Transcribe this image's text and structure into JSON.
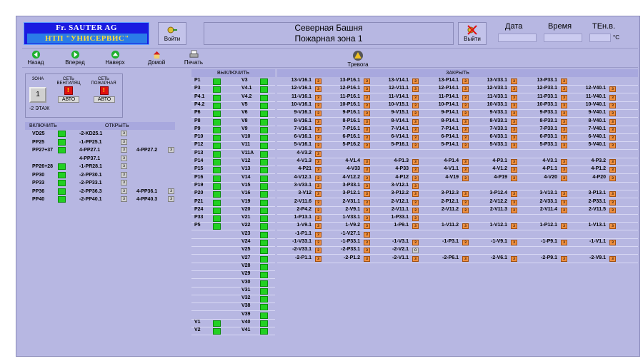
{
  "header": {
    "logo_line1": "Fr. SAUTER AG",
    "logo_line2": "НТП \"УНИСЕРВИС\"",
    "login_label": "Войти",
    "title_line1": "Северная Башня",
    "title_line2": "Пожарная зона 1",
    "logout_label": "Выйти",
    "date_label": "Дата",
    "time_label": "Время",
    "temp_label": "TEн.в.",
    "temp_unit": "°C"
  },
  "nav": [
    "Назад",
    "Вперед",
    "Наверх",
    "Домой",
    "Печать"
  ],
  "alarm_label": "Тревога",
  "zone": {
    "h_zone": "ЗОНА",
    "h_net": "СЕТЬ ВЕНТИЛЯЦ",
    "h_fire": "СЕТЬ ПОЖАРНАЯ",
    "button": "1",
    "auto1": "АВТО",
    "auto2": "АВТО",
    "floor": "-2 ЭТАЖ"
  },
  "left": {
    "h_on": "ВКЛЮЧИТЬ",
    "h_open": "ОТКРЫТЬ",
    "rows": [
      [
        "VD25",
        "-2-KD25.1",
        ""
      ],
      [
        "PP25",
        "-1-PP25.1",
        ""
      ],
      [
        "PP27+37",
        "4-PP27.1",
        "4-PP27.2"
      ],
      [
        "",
        "4-PP37.1",
        ""
      ],
      [
        "PP26+28",
        "-1-PR28.1",
        ""
      ],
      [
        "PP30",
        "-2-PP30.1",
        ""
      ],
      [
        "PP33",
        "-2-PP33.1",
        ""
      ],
      [
        "PP36",
        "-2-PP36.3",
        "4-PP36.1"
      ],
      [
        "PP40",
        "-2-PP40.1",
        "4-PP40.3"
      ]
    ]
  },
  "main": {
    "h_off": "ВЫКЛЮЧИТЬ",
    "h_close": "ЗАКРЫТЬ",
    "btn": "з",
    "btn_o": "о",
    "pcol": [
      "P1",
      "P3",
      "P4.1",
      "P4.2",
      "P6",
      "P8",
      "P9",
      "P10",
      "P12",
      "P13",
      "P14",
      "P15",
      "P16",
      "P19",
      "P20",
      "P21",
      "P24",
      "P33",
      "P5"
    ],
    "vcol": [
      "V3",
      "V4.1",
      "V4.2",
      "V5",
      "V6",
      "V8",
      "V9",
      "V10",
      "V11",
      "V11A",
      "V12",
      "V13",
      "V14",
      "V15",
      "V16",
      "V19",
      "V20",
      "V21",
      "V22",
      "V23",
      "V24",
      "V25",
      "V27",
      "V28",
      "V29",
      "V30",
      "V31",
      "V32",
      "V38",
      "V39",
      "V40",
      "V41"
    ],
    "vcolP2": [
      "V1",
      "V2"
    ],
    "grid": [
      [
        "13-V16.1",
        "13-P16.1",
        "13-V14.1",
        "13-P14.1",
        "13-V33.1",
        "13-P33.1",
        ""
      ],
      [
        "12-V16.1",
        "12-P16.1",
        "12-V11.1",
        "12-P14.1",
        "12-V33.1",
        "12-P33.1",
        "12-V40.1"
      ],
      [
        "11-V16.1",
        "11-P16.1",
        "11-V14.1",
        "11-P14.1",
        "11-V33.1",
        "11-P33.1",
        "11-V40.1"
      ],
      [
        "10-V16.1",
        "10-P16.1",
        "10-V15.1",
        "10-P14.1",
        "10-V33.1",
        "10-P33.1",
        "10-V40.1"
      ],
      [
        "9-V16.1",
        "9-P16.1",
        "9-V15.1",
        "9-P14.1",
        "9-V33.1",
        "9-P33.1",
        "9-V40.1"
      ],
      [
        "8-V16.1",
        "8-P16.1",
        "8-V14.1",
        "8-P14.1",
        "8-V33.1",
        "8-P33.1",
        "8-V40.1"
      ],
      [
        "7-V16.1",
        "7-P16.1",
        "7-V14.1",
        "7-P14.1",
        "7-V33.1",
        "7-P33.1",
        "7-V40.1"
      ],
      [
        "6-V16.1",
        "6-P16.1",
        "6-V14.1",
        "6-P14.1",
        "6-V33.1",
        "6-P33.1",
        "6-V40.1"
      ],
      [
        "5-V16.1",
        "5-P16.2",
        "5-P16.1",
        "5-P14.1",
        "5-V33.1",
        "5-P33.1",
        "5-V40.1"
      ],
      [
        "4-V3.2",
        "",
        "",
        "",
        "",
        "",
        ""
      ],
      [
        "4-V1.3",
        "4-V1.4",
        "4-P1.3",
        "4-P1.4",
        "4-P3.1",
        "4-V3.1",
        "4-P3.2"
      ],
      [
        "4-P21",
        "4-V33",
        "4-P33",
        "4-V1.1",
        "4-V1.2",
        "4-P1.1",
        "4-P1.2"
      ],
      [
        "4-V12.1",
        "4-V12.2",
        "4-P12",
        "4-V19",
        "4-P19",
        "4-V20",
        "4-P20"
      ],
      [
        "3-V33.1",
        "3-P33.1",
        "3-V12.1",
        "",
        "",
        "",
        ""
      ],
      [
        "3-V12",
        "3-P12.1",
        "3-P12.2",
        "3-P12.3",
        "3-P12.4",
        "3-V13.1",
        "3-P13.1"
      ],
      [
        "2-V11.6",
        "2-V31.1",
        "2-V12.1",
        "2-P12.1",
        "2-V12.2",
        "2-V33.1",
        "2-P33.1"
      ],
      [
        "2-P4.2",
        "2-V9.1",
        "2-V11.1",
        "2-V11.2",
        "2-V11.3",
        "2-V11.4",
        "2-V11.5"
      ],
      [
        "1-P13.1",
        "1-V33.1",
        "1-P33.1",
        "",
        "",
        "",
        ""
      ],
      [
        "1-V9.1",
        "1-V9.2",
        "1-P9.1",
        "1-V11.2",
        "1-V12.1",
        "1-P12.1",
        "1-V13.1"
      ],
      [
        "-1-P1.1",
        "-1-V27.1",
        "",
        "",
        "",
        "",
        ""
      ],
      [
        "-1-V33.1",
        "-1-P33.1",
        "-1-V3.1",
        "-1-P3.1",
        "-1-V9.1",
        "-1-P9.1",
        "-1-V1.1"
      ],
      [
        "-2-V33.1",
        "-2-P33.1",
        "-2-V2.1",
        "",
        "",
        "",
        ""
      ],
      [
        "-2-P1.1",
        "-2-P1.2",
        "-2-V1.1",
        "-2-P6.1",
        "-2-V6.1",
        "-2-P9.1",
        "-2-V9.1"
      ]
    ]
  }
}
